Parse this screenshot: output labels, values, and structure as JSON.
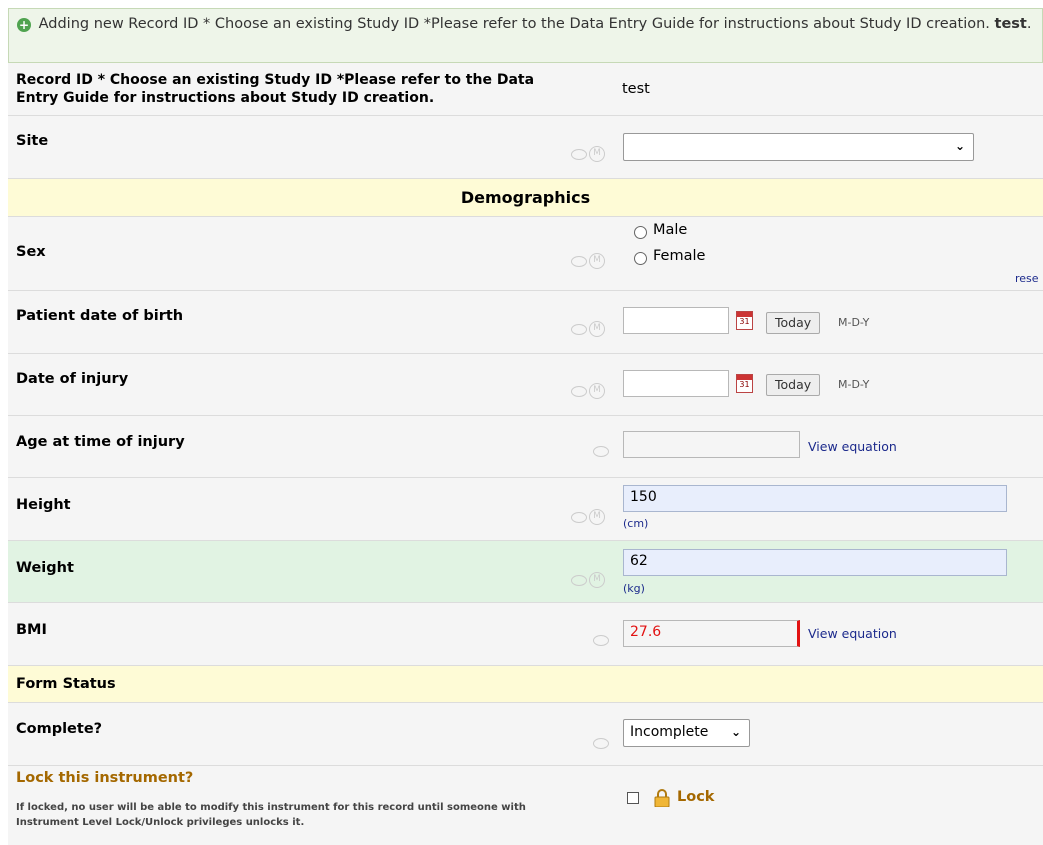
{
  "banner": {
    "text": "Adding new Record ID * Choose an existing Study ID *Please refer to the Data Entry Guide for instructions about Study ID creation.",
    "record": "test"
  },
  "record": {
    "label": "Record ID * Choose an existing Study ID *Please refer to the Data Entry Guide for instructions about Study ID creation.",
    "value": "test"
  },
  "site": {
    "label": "Site",
    "value": ""
  },
  "demographics": {
    "title": "Demographics"
  },
  "sex": {
    "label": "Sex",
    "options": [
      "Male",
      "Female"
    ],
    "reset": "rese"
  },
  "dob": {
    "label": "Patient date of birth",
    "value": "",
    "today": "Today",
    "format": "M-D-Y"
  },
  "injury_date": {
    "label": "Date of injury",
    "value": "",
    "today": "Today",
    "format": "M-D-Y"
  },
  "age": {
    "label": "Age at time of injury",
    "value": "",
    "link": "View equation"
  },
  "height": {
    "label": "Height",
    "value": "150",
    "units": "(cm)"
  },
  "weight": {
    "label": "Weight",
    "value": "62",
    "units": "(kg)"
  },
  "bmi": {
    "label": "BMI",
    "value": "27.6",
    "link": "View equation"
  },
  "form_status": {
    "title": "Form Status"
  },
  "complete": {
    "label": "Complete?",
    "value": "Incomplete"
  },
  "lock": {
    "label": "Lock this instrument?",
    "note": "If locked, no user will be able to modify this instrument for this record until someone with Instrument Level Lock/Unlock privileges unlocks it.",
    "checkbox_label": "Lock"
  },
  "colors": {
    "accent_link": "#1c2a8c",
    "calc_value": "#e21212",
    "lock_label": "#a46800"
  }
}
